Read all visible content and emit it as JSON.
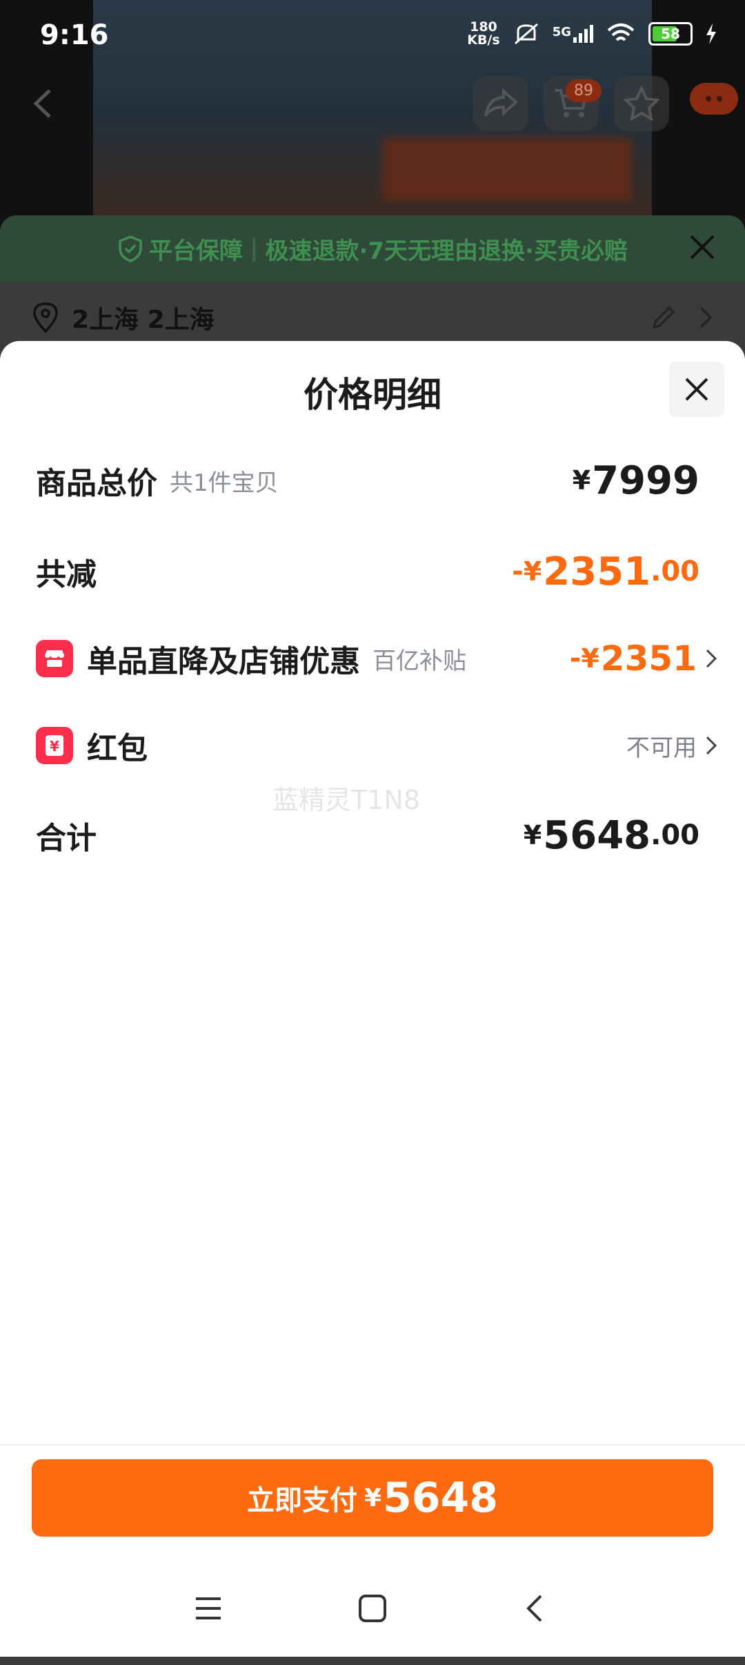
{
  "status_bar": {
    "time": "9:16",
    "speed_value": "180",
    "speed_unit": "KB/s",
    "network": "5G",
    "battery": "58"
  },
  "background": {
    "cart_count": "89",
    "guarantee": {
      "title": "平台保障",
      "separator": "|",
      "text": "极速退款·7天无理由退换·买贵必赔"
    },
    "address": "2上海 2上海"
  },
  "sheet": {
    "title": "价格明细",
    "rows": {
      "total": {
        "label": "商品总价",
        "sub": "共1件宝贝",
        "yen": "¥",
        "amount": "7999"
      },
      "reduce": {
        "label": "共减",
        "prefix": "-",
        "yen": "¥",
        "amount": "2351",
        "decimal": ".00"
      },
      "discount": {
        "label": "单品直降及店铺优惠",
        "sub": "百亿补贴",
        "prefix": "-",
        "yen": "¥",
        "amount": "2351"
      },
      "redpacket": {
        "label": "红包",
        "status": "不可用"
      },
      "sum": {
        "label": "合计",
        "yen": "¥",
        "amount": "5648",
        "decimal": ".00"
      }
    },
    "watermark": "蓝精灵T1N8"
  },
  "pay_button": {
    "label": "立即支付",
    "yen": "¥",
    "amount": "5648"
  },
  "colors": {
    "accent": "#ff6a10",
    "badge_red": "#ff2e4d"
  }
}
